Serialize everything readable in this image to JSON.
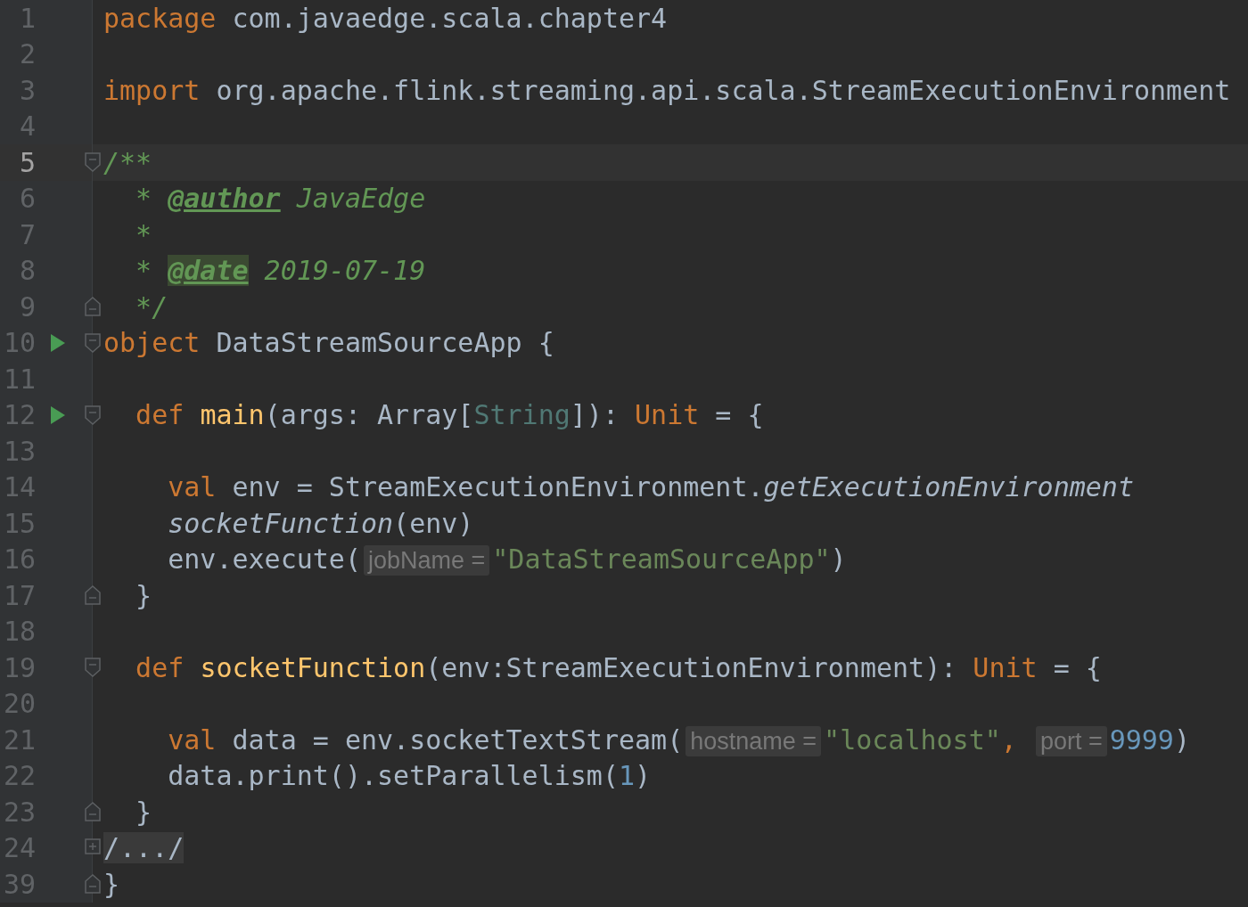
{
  "editor": {
    "lines": [
      {
        "number": "1",
        "current": false,
        "run": false,
        "fold_start": false,
        "fold_end": false,
        "collapsed": false,
        "tokens": [
          {
            "kind": "keyword",
            "text": "package"
          },
          {
            "kind": "plain",
            "text": " com.javaedge.scala.chapter4"
          }
        ]
      },
      {
        "number": "2",
        "current": false,
        "run": false,
        "fold_start": false,
        "fold_end": false,
        "collapsed": false
      },
      {
        "number": "3",
        "current": false,
        "run": false,
        "fold_start": false,
        "fold_end": false,
        "collapsed": false,
        "tokens": [
          {
            "kind": "keyword",
            "text": "import"
          },
          {
            "kind": "plain",
            "text": " org.apache.flink.streaming.api.scala.StreamExecutionEnvironment"
          }
        ]
      },
      {
        "number": "4",
        "current": false,
        "run": false,
        "fold_start": false,
        "fold_end": false,
        "collapsed": false
      },
      {
        "number": "5",
        "current": true,
        "run": false,
        "fold_start": true,
        "fold_end": false,
        "collapsed": false,
        "tokens": [
          {
            "kind": "doc",
            "text": "/**"
          }
        ]
      },
      {
        "number": "6",
        "current": false,
        "run": false,
        "fold_start": false,
        "fold_end": false,
        "collapsed": false,
        "tokens": [
          {
            "kind": "doc",
            "text": "  * "
          },
          {
            "kind": "doctag",
            "text": "@author"
          },
          {
            "kind": "doc",
            "text": " JavaEdge"
          }
        ]
      },
      {
        "number": "7",
        "current": false,
        "run": false,
        "fold_start": false,
        "fold_end": false,
        "collapsed": false,
        "tokens": [
          {
            "kind": "doc",
            "text": "  *"
          }
        ]
      },
      {
        "number": "8",
        "current": false,
        "run": false,
        "fold_start": false,
        "fold_end": false,
        "collapsed": false,
        "tokens": [
          {
            "kind": "doc",
            "text": "  * "
          },
          {
            "kind": "doctag-marked",
            "text": "@date"
          },
          {
            "kind": "doc",
            "text": " 2019-07-19"
          }
        ]
      },
      {
        "number": "9",
        "current": false,
        "run": false,
        "fold_start": false,
        "fold_end": true,
        "collapsed": false,
        "tokens": [
          {
            "kind": "doc",
            "text": "  */"
          }
        ]
      },
      {
        "number": "10",
        "current": false,
        "run": true,
        "fold_start": true,
        "fold_end": false,
        "collapsed": false,
        "tokens": [
          {
            "kind": "keyword",
            "text": "object"
          },
          {
            "kind": "plain",
            "text": " DataStreamSourceApp {"
          }
        ]
      },
      {
        "number": "11",
        "current": false,
        "run": false,
        "fold_start": false,
        "fold_end": false,
        "collapsed": false
      },
      {
        "number": "12",
        "current": false,
        "run": true,
        "fold_start": true,
        "fold_end": false,
        "collapsed": false,
        "tokens": [
          {
            "kind": "keyword",
            "text": "  def "
          },
          {
            "kind": "function",
            "text": "main"
          },
          {
            "kind": "plain",
            "text": "(args: Array["
          },
          {
            "kind": "type-param",
            "text": "String"
          },
          {
            "kind": "plain",
            "text": "]): "
          },
          {
            "kind": "keyword",
            "text": "Unit"
          },
          {
            "kind": "plain",
            "text": " = {"
          }
        ]
      },
      {
        "number": "13",
        "current": false,
        "run": false,
        "fold_start": false,
        "fold_end": false,
        "collapsed": false
      },
      {
        "number": "14",
        "current": false,
        "run": false,
        "fold_start": false,
        "fold_end": false,
        "collapsed": false,
        "tokens": [
          {
            "kind": "keyword",
            "text": "    val"
          },
          {
            "kind": "plain",
            "text": " env = StreamExecutionEnvironment."
          },
          {
            "kind": "italic",
            "text": "getExecutionEnvironment"
          }
        ]
      },
      {
        "number": "15",
        "current": false,
        "run": false,
        "fold_start": false,
        "fold_end": false,
        "collapsed": false,
        "tokens": [
          {
            "kind": "italic",
            "text": "    socketFunction"
          },
          {
            "kind": "plain",
            "text": "(env)"
          }
        ]
      },
      {
        "number": "16",
        "current": false,
        "run": false,
        "fold_start": false,
        "fold_end": false,
        "collapsed": false,
        "tokens": [
          {
            "kind": "plain",
            "text": "    env.execute("
          },
          {
            "kind": "hint",
            "text": "jobName ="
          },
          {
            "kind": "string",
            "text": "\"DataStreamSourceApp\""
          },
          {
            "kind": "plain",
            "text": ")"
          }
        ]
      },
      {
        "number": "17",
        "current": false,
        "run": false,
        "fold_start": false,
        "fold_end": true,
        "collapsed": false,
        "tokens": [
          {
            "kind": "plain",
            "text": "  }"
          }
        ]
      },
      {
        "number": "18",
        "current": false,
        "run": false,
        "fold_start": false,
        "fold_end": false,
        "collapsed": false
      },
      {
        "number": "19",
        "current": false,
        "run": false,
        "fold_start": true,
        "fold_end": false,
        "collapsed": false,
        "tokens": [
          {
            "kind": "keyword",
            "text": "  def "
          },
          {
            "kind": "function",
            "text": "socketFunction"
          },
          {
            "kind": "plain",
            "text": "(env:StreamExecutionEnvironment): "
          },
          {
            "kind": "keyword",
            "text": "Unit"
          },
          {
            "kind": "plain",
            "text": " = {"
          }
        ]
      },
      {
        "number": "20",
        "current": false,
        "run": false,
        "fold_start": false,
        "fold_end": false,
        "collapsed": false
      },
      {
        "number": "21",
        "current": false,
        "run": false,
        "fold_start": false,
        "fold_end": false,
        "collapsed": false,
        "tokens": [
          {
            "kind": "keyword",
            "text": "    val"
          },
          {
            "kind": "plain",
            "text": " data = env.socketTextStream("
          },
          {
            "kind": "hint",
            "text": "hostname ="
          },
          {
            "kind": "string",
            "text": "\"localhost\""
          },
          {
            "kind": "keyword",
            "text": ", "
          },
          {
            "kind": "hint",
            "text": "port ="
          },
          {
            "kind": "number",
            "text": "9999"
          },
          {
            "kind": "plain",
            "text": ")"
          }
        ]
      },
      {
        "number": "22",
        "current": false,
        "run": false,
        "fold_start": false,
        "fold_end": false,
        "collapsed": false,
        "tokens": [
          {
            "kind": "plain",
            "text": "    data.print().setParallelism("
          },
          {
            "kind": "number",
            "text": "1"
          },
          {
            "kind": "plain",
            "text": ")"
          }
        ]
      },
      {
        "number": "23",
        "current": false,
        "run": false,
        "fold_start": false,
        "fold_end": true,
        "collapsed": false,
        "tokens": [
          {
            "kind": "plain",
            "text": "  }"
          }
        ]
      },
      {
        "number": "24",
        "current": false,
        "run": false,
        "fold_start": false,
        "fold_end": false,
        "collapsed": true,
        "tokens": [
          {
            "kind": "folded",
            "text": "/.../"
          }
        ]
      },
      {
        "number": "39",
        "current": false,
        "run": false,
        "fold_start": false,
        "fold_end": true,
        "collapsed": false,
        "tokens": [
          {
            "kind": "plain",
            "text": "}"
          }
        ]
      }
    ]
  }
}
